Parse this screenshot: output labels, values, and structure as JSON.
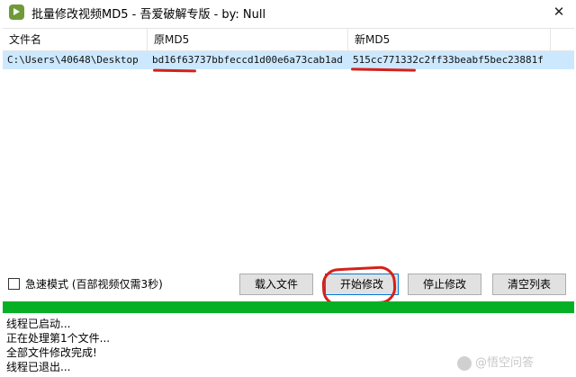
{
  "window": {
    "title": "批量修改视频MD5 - 吾爱破解专版 - by: Null",
    "close_glyph": "✕"
  },
  "list": {
    "columns": [
      "文件名",
      "原MD5",
      "新MD5"
    ],
    "rows": [
      {
        "file": "C:\\Users\\40648\\Desktop",
        "old_md5": "bd16f63737bbfeccd1d00e6a73cab1ad",
        "new_md5": "515cc771332c2ff33beabf5bec23881f"
      }
    ]
  },
  "controls": {
    "fast_mode_label": "急速模式 (百部视频仅需3秒)",
    "fast_mode_checked": false,
    "load_button": "载入文件",
    "start_button": "开始修改",
    "stop_button": "停止修改",
    "clear_button": "清空列表"
  },
  "progress": {
    "value": 1.0,
    "color": "#06b025"
  },
  "log": [
    "线程已启动...",
    "正在处理第1个文件...",
    "全部文件修改完成!",
    "线程已退出..."
  ],
  "watermark": "@悟空问答"
}
